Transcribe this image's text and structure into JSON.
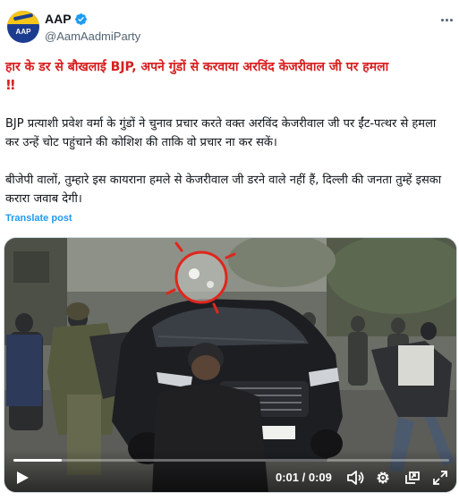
{
  "author": {
    "display_name": "AAP",
    "handle": "@AamAadmiParty",
    "avatar_text": "AAP",
    "verified_icon": "verified-badge-icon"
  },
  "menu": {
    "icon": "more-horizontal-icon"
  },
  "post": {
    "headline": "हार के डर से बौखलाई BJP, अपने गुंडों से करवाया अरविंद केजरीवाल जी पर हमला",
    "headline_emoji": "!!",
    "paragraph1": "BJP प्रत्याशी प्रवेश वर्मा के गुंडों ने चुनाव प्रचार करते वक्त अरविंद केजरीवाल जी पर ईंट-पत्थर से हमला कर उन्हें चोट पहुंचाने की कोशिश की ताकि वो प्रचार ना कर सकें।",
    "paragraph2": "बीजेपी वालों, तुम्हारे इस कायराना हमले से केजरीवाल जी डरने वाले नहीं हैं, दिल्ली की जनता तुम्हें इसका करारा जवाब देगी।",
    "translate_label": "Translate post"
  },
  "video": {
    "time_display": "0:01 / 0:09",
    "progress_fraction": 0.111,
    "highlight_color": "#e0261d",
    "icons": [
      "play-icon",
      "volume-icon",
      "settings-gear-icon",
      "picture-in-picture-icon",
      "fullscreen-icon"
    ]
  },
  "colors": {
    "headline": "#d81e1e",
    "link": "#1d9bf0",
    "secondary_text": "#536471",
    "verified": "#1d9bf0"
  }
}
